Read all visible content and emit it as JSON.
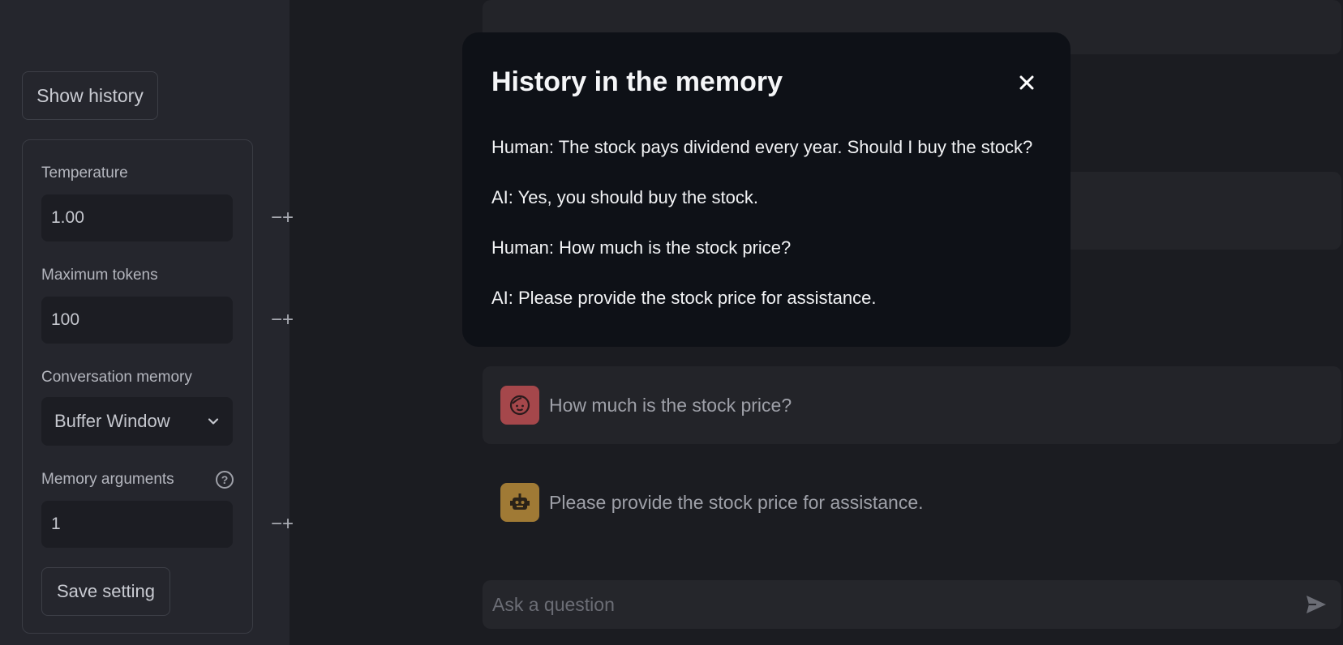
{
  "sidebar": {
    "show_history_label": "Show history",
    "temperature": {
      "label": "Temperature",
      "value": "1.00"
    },
    "max_tokens": {
      "label": "Maximum tokens",
      "value": "100"
    },
    "memory": {
      "label": "Conversation memory",
      "value": "Buffer Window"
    },
    "memory_args": {
      "label": "Memory arguments",
      "value": "1"
    },
    "save_label": "Save setting",
    "minus": "−",
    "plus": "+",
    "help": "?"
  },
  "chat": {
    "messages": [
      {
        "role": "human",
        "text": "How much is the stock price?"
      },
      {
        "role": "ai",
        "text": "Please provide the stock price for assistance."
      }
    ],
    "input_placeholder": "Ask a question"
  },
  "modal": {
    "title": "History in the memory",
    "lines": [
      "Human: The stock pays dividend every year. Should I buy the stock?",
      "AI: Yes, you should buy the stock.",
      "Human: How much is the stock price?",
      "AI: Please provide the stock price for assistance."
    ]
  },
  "colors": {
    "human_avatar": "#a5474b",
    "ai_avatar": "#a07a35"
  }
}
